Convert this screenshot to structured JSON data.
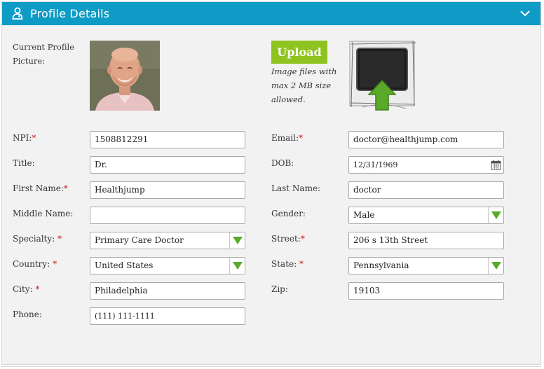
{
  "header": {
    "title": "Profile Details",
    "user_icon": "user-md-icon",
    "collapse_icon": "chevron-down-icon"
  },
  "picture": {
    "label": "Current Profile Picture:",
    "upload_label": "Upload",
    "upload_note": "Image files with max 2 MB size allowed.",
    "upload_illustration": "image-upload-icon"
  },
  "fields": {
    "npi": {
      "label": "NPI:",
      "value": "1508812291",
      "required": true
    },
    "email": {
      "label": "Email:",
      "value": "doctor@healthjump.com",
      "required": true
    },
    "title": {
      "label": "Title:",
      "value": "Dr."
    },
    "dob": {
      "label": "DOB:",
      "value": "12/31/1969"
    },
    "first_name": {
      "label": "First Name:",
      "value": "Healthjump",
      "required": true
    },
    "last_name": {
      "label": "Last Name:",
      "value": "doctor"
    },
    "middle_name": {
      "label": "Middle Name:",
      "value": ""
    },
    "gender": {
      "label": "Gender:",
      "value": "Male"
    },
    "specialty": {
      "label": "Specialty: ",
      "value": "Primary Care Doctor",
      "required": true
    },
    "street": {
      "label": "Street:",
      "value": "206 s 13th Street",
      "required": true
    },
    "country": {
      "label": "Country: ",
      "value": "United States",
      "required": true
    },
    "state": {
      "label": "State: ",
      "value": "Pennsylvania",
      "required": true
    },
    "city": {
      "label": "City: ",
      "value": "Philadelphia",
      "required": true
    },
    "zip": {
      "label": "Zip:",
      "value": "19103"
    },
    "phone": {
      "label": "Phone:",
      "value": "(111) 111-1111"
    }
  },
  "colors": {
    "header": "#0e9bc6",
    "accent_green": "#8fc31f",
    "required": "#d9141c",
    "arrow_green": "#5aaa2a"
  }
}
